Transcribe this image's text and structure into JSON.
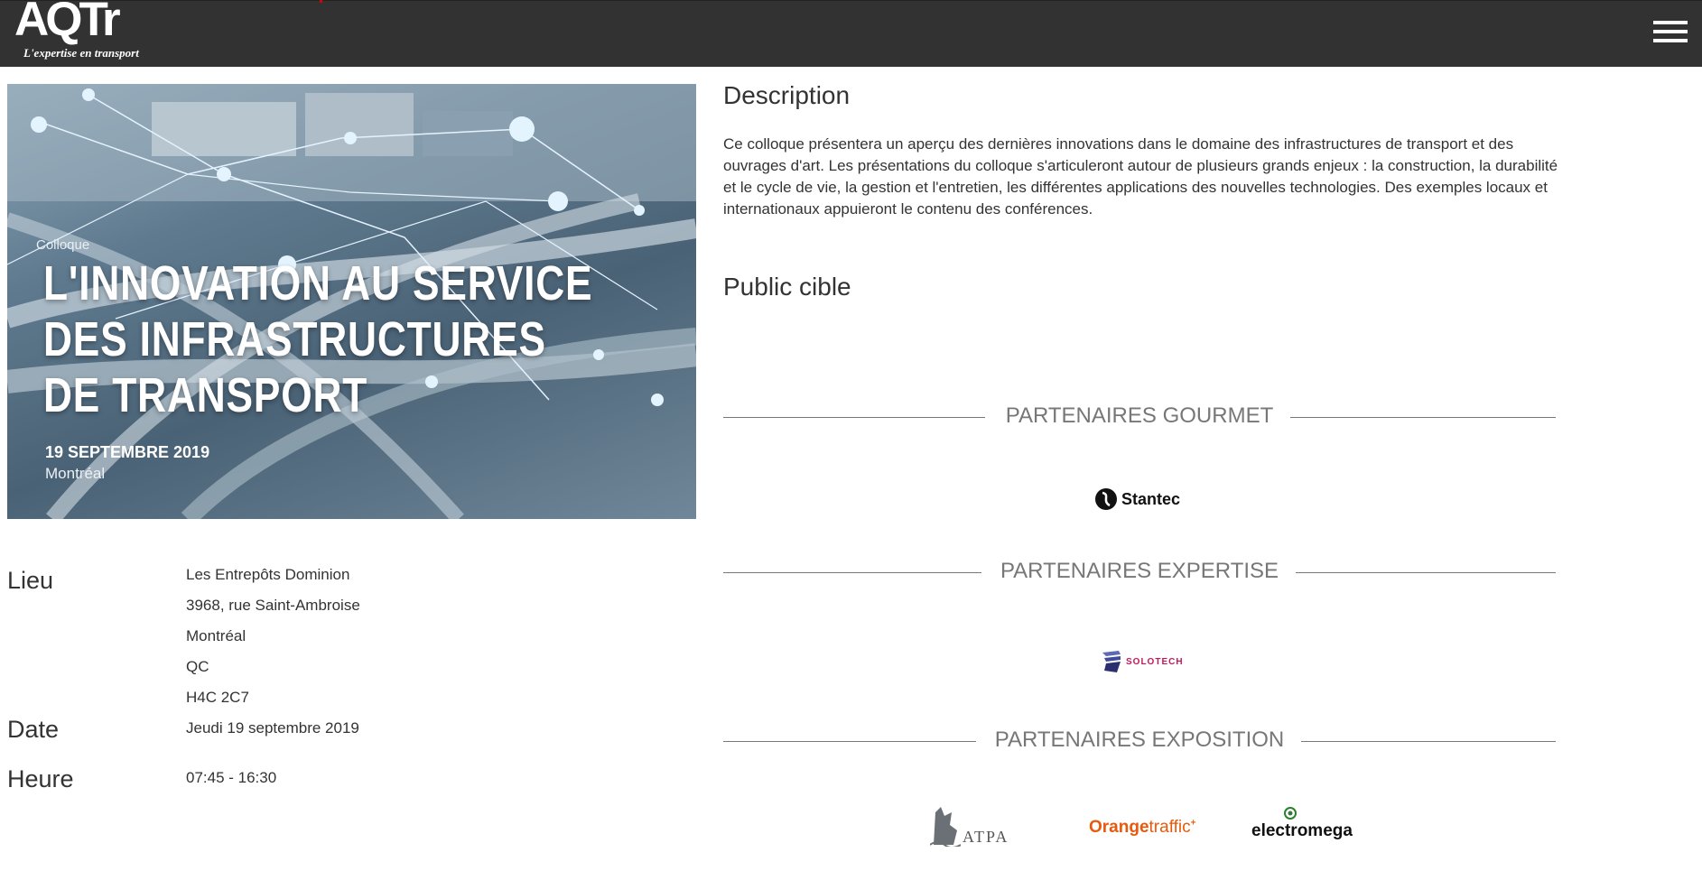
{
  "header": {
    "logo_text": "AQTr",
    "logo_tagline": "L'expertise en transport",
    "menu_icon": "hamburger-menu-icon",
    "bg_color": "#323232"
  },
  "hero": {
    "kicker": "Colloque",
    "title_lines": [
      "L'INNOVATION AU SERVICE",
      "DES INFRASTRUCTURES",
      "DE TRANSPORT"
    ],
    "date": "19 SEPTEMBRE 2019",
    "city": "Montréal"
  },
  "info": {
    "lieu_label": "Lieu",
    "lieu_lines": [
      "Les Entrepôts Dominion",
      "3968, rue Saint-Ambroise",
      "Montréal",
      "QC",
      "H4C 2C7"
    ],
    "date_label": "Date",
    "date_value": "Jeudi 19 septembre 2019",
    "heure_label": "Heure",
    "heure_value": "07:45 - 16:30"
  },
  "description": {
    "heading": "Description",
    "text": "Ce colloque présentera un aperçu des dernières innovations dans le domaine des infrastructures de transport et des ouvrages d'art. Les présentations du colloque s'articuleront autour de plusieurs grands enjeux : la construction, la durabilité et le cycle de vie, la gestion et l'entretien, les différentes applications des nouvelles technologies. Des exemples locaux et internationaux appuieront le contenu des conférences."
  },
  "public": {
    "heading": "Public cible"
  },
  "partners": {
    "gourmet_heading": "PARTENAIRES GOURMET",
    "gourmet_logos": [
      "Stantec"
    ],
    "expertise_heading": "PARTENAIRES EXPERTISE",
    "expertise_logos": [
      "SOLOTECH"
    ],
    "exposition_heading": "PARTENAIRES EXPOSITION",
    "exposition_logos": [
      "ATPA",
      "Orange",
      "traffic",
      "electromega"
    ]
  }
}
